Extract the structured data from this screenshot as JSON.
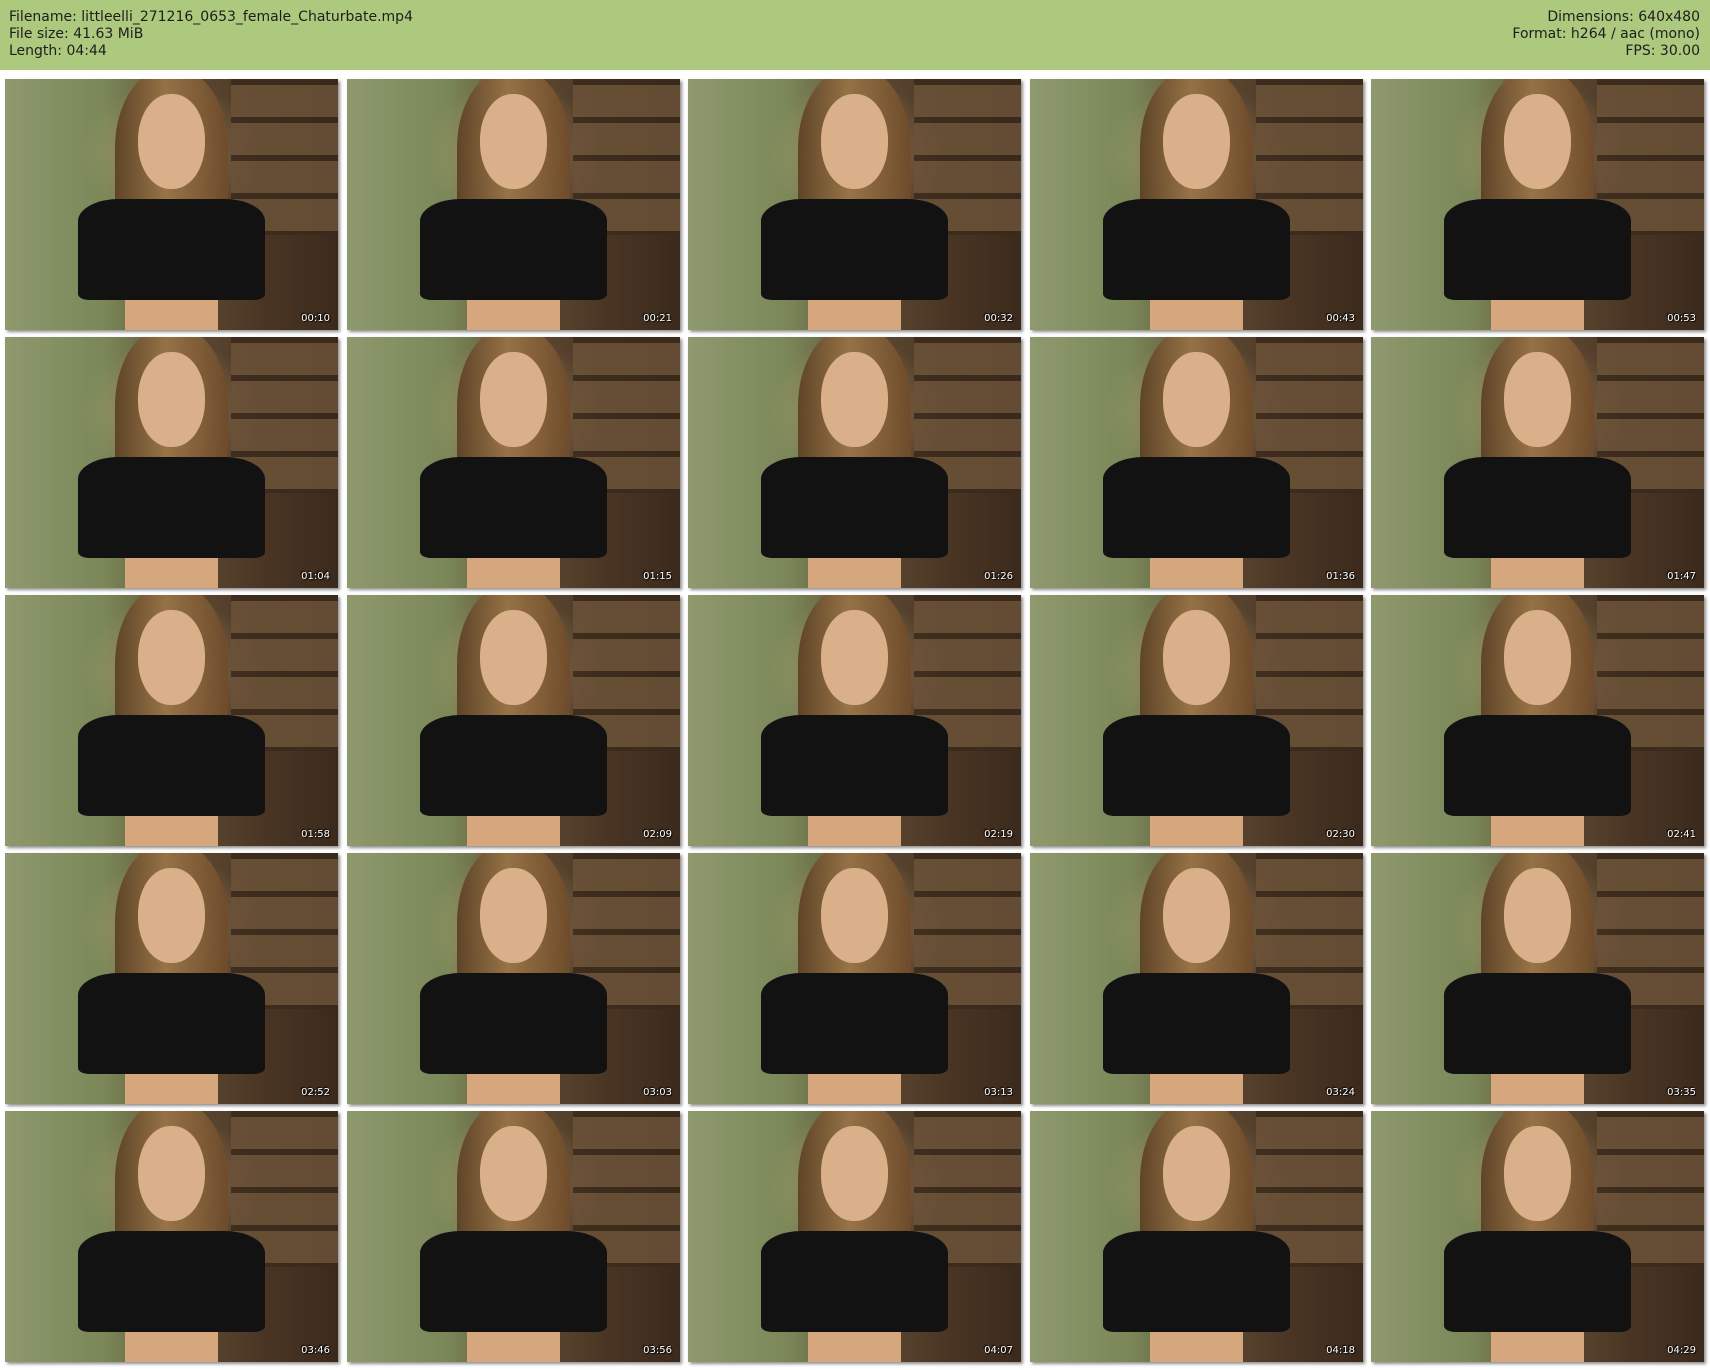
{
  "header": {
    "filename": "Filename: littleelli_271216_0653_female_Chaturbate.mp4",
    "file_size": "File size: 41.63 MiB",
    "length": "Length: 04:44",
    "dimensions": "Dimensions: 640x480",
    "format": "Format: h264 / aac (mono)",
    "fps": "FPS: 30.00",
    "background_color": "#acc97e"
  },
  "timestamps": [
    "00:10",
    "00:21",
    "00:32",
    "00:43",
    "00:53",
    "01:04",
    "01:15",
    "01:26",
    "01:36",
    "01:47",
    "01:58",
    "02:09",
    "02:19",
    "02:30",
    "02:41",
    "02:52",
    "03:03",
    "03:13",
    "03:24",
    "03:35",
    "03:46",
    "03:56",
    "04:07",
    "04:18",
    "04:29"
  ]
}
